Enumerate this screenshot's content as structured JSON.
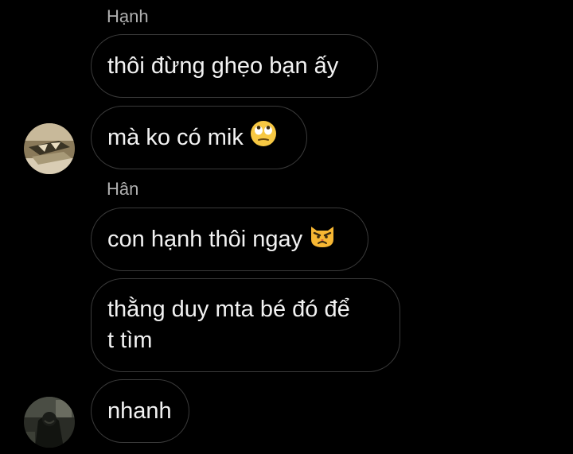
{
  "messages": [
    {
      "sender": "Hạnh",
      "text": "thôi đừng ghẹo bạn ấy"
    },
    {
      "text": "mà ko có mik",
      "emoji": "face-with-rolling-eyes-icon"
    },
    {
      "sender": "Hân",
      "text": "con hạnh thôi ngay",
      "emoji": "pouting-cat-icon"
    },
    {
      "text": "thằng duy mta bé đó để\nt tìm"
    },
    {
      "text": "nhanh"
    }
  ],
  "colors": {
    "background": "#000000",
    "bubble_border": "#3a3a3a",
    "text": "#f2f2f2",
    "sender_name": "#b0b0b0",
    "emoji_yellow": "#f7c843"
  }
}
